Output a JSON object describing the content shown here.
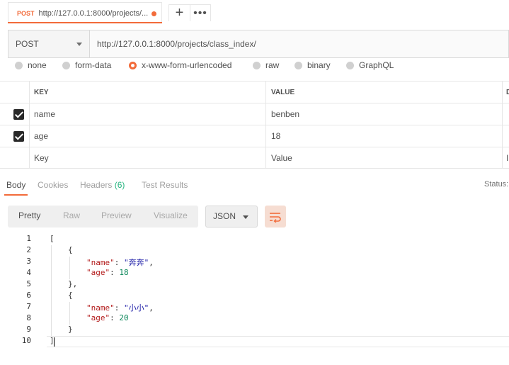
{
  "tab": {
    "method": "POST",
    "title": "http://127.0.0.1:8000/projects/..."
  },
  "request": {
    "method": "POST",
    "url": "http://127.0.0.1:8000/projects/class_index/"
  },
  "body_types": [
    "none",
    "form-data",
    "x-www-form-urlencoded",
    "raw",
    "binary",
    "GraphQL"
  ],
  "body_type_selected": "x-www-form-urlencoded",
  "params_table": {
    "headers": {
      "key": "KEY",
      "value": "VALUE",
      "desc": "D"
    },
    "rows": [
      {
        "key": "name",
        "value": "benben",
        "checked": true
      },
      {
        "key": "age",
        "value": "18",
        "checked": true
      }
    ],
    "placeholder": {
      "key": "Key",
      "value": "Value",
      "desc": "I"
    }
  },
  "response_tabs": {
    "body": "Body",
    "cookies": "Cookies",
    "headers": "Headers",
    "headers_count": "(6)",
    "test_results": "Test Results",
    "status": "Status:"
  },
  "format": {
    "pretty": "Pretty",
    "raw": "Raw",
    "preview": "Preview",
    "visualize": "Visualize",
    "language": "JSON"
  },
  "code": {
    "line_numbers": [
      "1",
      "2",
      "3",
      "4",
      "5",
      "6",
      "7",
      "8",
      "9",
      "10"
    ],
    "lines": [
      {
        "open": "["
      },
      {
        "open": "{"
      },
      {
        "key": "\"name\"",
        "sep": ": ",
        "str": "\"奔奔\"",
        "end": ","
      },
      {
        "key": "\"age\"",
        "sep": ": ",
        "num": "18"
      },
      {
        "close": "},"
      },
      {
        "open": "{"
      },
      {
        "key": "\"name\"",
        "sep": ": ",
        "str": "\"小小\"",
        "end": ","
      },
      {
        "key": "\"age\"",
        "sep": ": ",
        "num": "20"
      },
      {
        "close": "}"
      },
      {
        "close": "]"
      }
    ]
  },
  "colors": {
    "accent": "#f26b3a",
    "count": "#26b47f"
  }
}
